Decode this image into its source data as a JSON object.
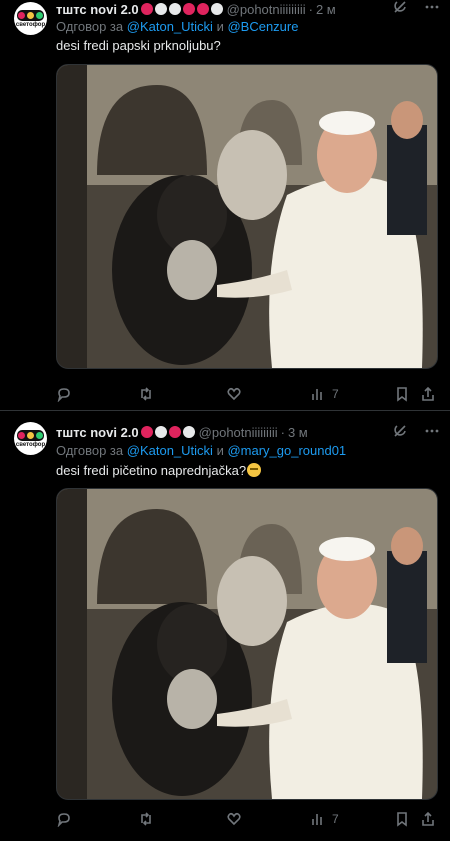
{
  "tweets": [
    {
      "name": "тштс novi 2.0",
      "badges": [
        "#e0245e",
        "#e7e9ea",
        "#e7e9ea",
        "#e0245e",
        "#e0245e",
        "#e7e9ea"
      ],
      "handle": "@pohotniiiiiiiii",
      "separator": "·",
      "time": "2 м",
      "reply_prefix": "Одговор за",
      "mention1": "@Katon_Uticki",
      "conj": "и",
      "mention2": "@BCenzure",
      "text": "desi fredi papski prknoljubu?",
      "views": "7",
      "avatar_brand": "светофор"
    },
    {
      "name": "тштс novi 2.0",
      "badges": [
        "#e0245e",
        "#e7e9ea",
        "#e0245e",
        "#e7e9ea"
      ],
      "handle": "@pohotniiiiiiiii",
      "separator": "·",
      "time": "3 м",
      "reply_prefix": "Одговор за",
      "mention1": "@Katon_Uticki",
      "conj": "и",
      "mention2": "@mary_go_round01",
      "text": "desi fredi pičetino naprednjačka?",
      "views": "7",
      "avatar_brand": "светофор"
    }
  ],
  "icons": {
    "grok": "grok-icon",
    "more": "more-icon",
    "reply": "reply-icon",
    "retweet": "retweet-icon",
    "like": "like-icon",
    "views": "views-icon",
    "bookmark": "bookmark-icon",
    "share": "share-icon"
  },
  "colors": {
    "accent": "#1d9bf0",
    "muted": "#71767b",
    "text": "#e7e9ea",
    "bg": "#000000"
  }
}
